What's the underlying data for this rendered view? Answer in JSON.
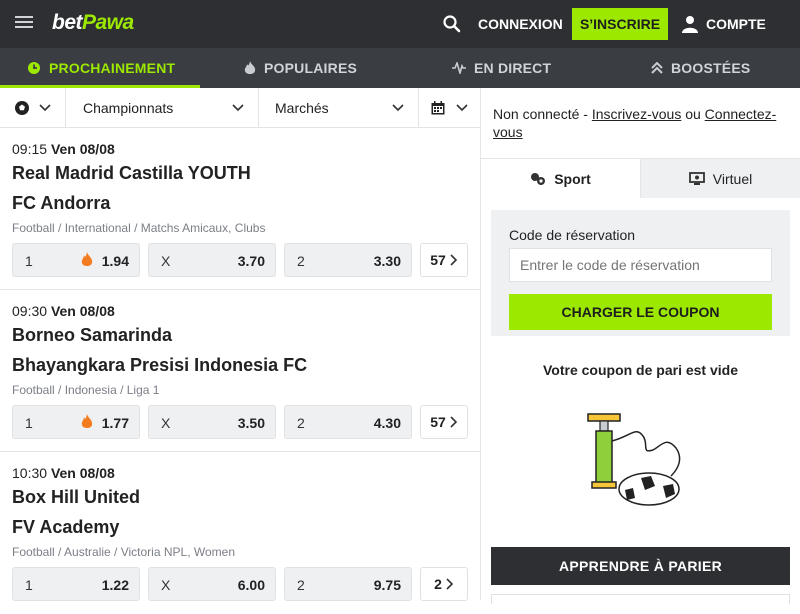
{
  "header": {
    "logo_bet": "bet",
    "logo_pawa": "Pawa",
    "login_label": "CONNEXION",
    "signup_label": "S’INSCRIRE",
    "account_label": "COMPTE"
  },
  "nav_tabs": [
    {
      "label": "PROCHAINEMENT",
      "icon": "clock-icon",
      "active": true
    },
    {
      "label": "POPULAIRES",
      "icon": "flame-icon",
      "active": false
    },
    {
      "label": "EN DIRECT",
      "icon": "pulse-icon",
      "active": false
    },
    {
      "label": "BOOSTÉES",
      "icon": "double-chevron-up-icon",
      "active": false
    }
  ],
  "filters": {
    "sport_icon": "soccer-ball-icon",
    "championships_label": "Championnats",
    "markets_label": "Marchés",
    "calendar_icon": "calendar-icon"
  },
  "events": [
    {
      "time": "09:15",
      "date": "Ven 08/08",
      "team1": "Real Madrid Castilla YOUTH",
      "team2": "FC Andorra",
      "category": "Football / International / Matchs Amicaux, Clubs",
      "odds": [
        {
          "label": "1",
          "value": "1.94",
          "hot": true
        },
        {
          "label": "X",
          "value": "3.70",
          "hot": false
        },
        {
          "label": "2",
          "value": "3.30",
          "hot": false
        }
      ],
      "more": "57"
    },
    {
      "time": "09:30",
      "date": "Ven 08/08",
      "team1": "Borneo Samarinda",
      "team2": "Bhayangkara Presisi Indonesia FC",
      "category": "Football / Indonesia / Liga 1",
      "odds": [
        {
          "label": "1",
          "value": "1.77",
          "hot": true
        },
        {
          "label": "X",
          "value": "3.50",
          "hot": false
        },
        {
          "label": "2",
          "value": "4.30",
          "hot": false
        }
      ],
      "more": "57"
    },
    {
      "time": "10:30",
      "date": "Ven 08/08",
      "team1": "Box Hill United",
      "team2": "FV Academy",
      "category": "Football / Australie / Victoria NPL, Women",
      "odds": [
        {
          "label": "1",
          "value": "1.22",
          "hot": false
        },
        {
          "label": "X",
          "value": "6.00",
          "hot": false
        },
        {
          "label": "2",
          "value": "9.75",
          "hot": false
        }
      ],
      "more": "2"
    }
  ],
  "sidebar": {
    "not_connected_text": "Non connecté - ",
    "register_link": "Inscrivez-vous",
    "or_text": " ou ",
    "login_link": "Connectez-vous",
    "tab_sport": "Sport",
    "tab_virtual": "Virtuel",
    "booking_label": "Code de réservation",
    "booking_placeholder": "Entrer le code de réservation",
    "load_coupon": "CHARGER LE COUPON",
    "empty_betslip": "Votre coupon de pari est vide",
    "learn_button": "APPRENDRE À PARIER"
  },
  "colors": {
    "brand_green": "#9ce800",
    "header_dark": "#2d2f33",
    "hot_orange": "#f47c20"
  }
}
